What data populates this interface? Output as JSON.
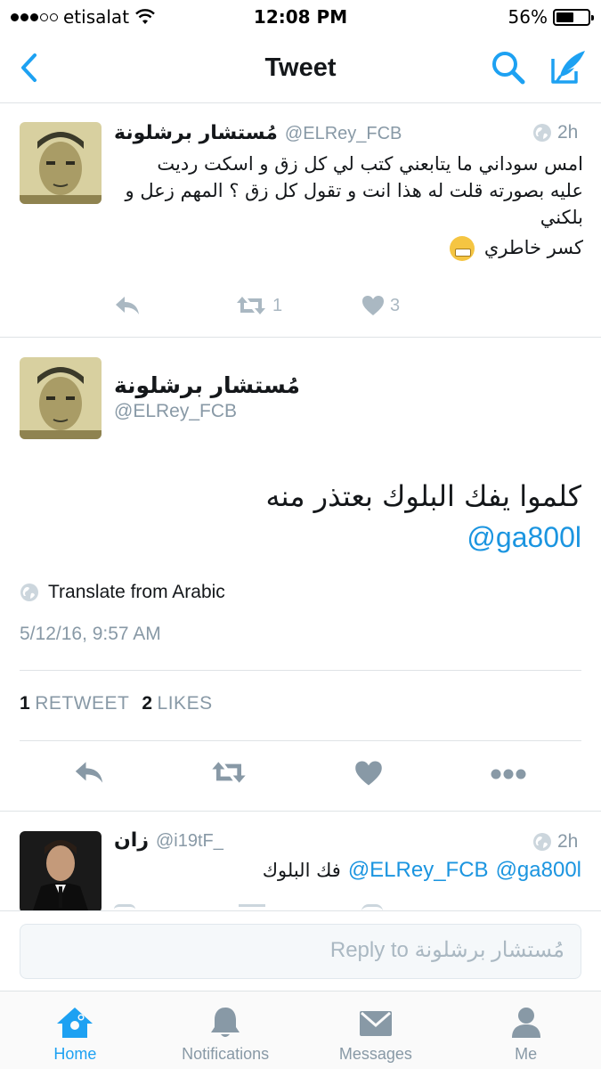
{
  "status_bar": {
    "carrier": "etisalat",
    "time": "12:08 PM",
    "battery_percent": "56%",
    "battery_level": 0.56
  },
  "nav": {
    "title": "Tweet",
    "back_icon": "chevron-left-icon",
    "search_icon": "search-icon",
    "compose_icon": "compose-icon"
  },
  "parent_tweet": {
    "display_name": "مُستشار برشلونة",
    "username": "@ELRey_FCB",
    "time": "2h",
    "text_line1": "امس سوداني ما يتابعني كتب لي كل زق و اسكت رديت عليه بصورته قلت له هذا انت و تقول كل زق ؟ المهم زعل و بلكني",
    "text_line2": "كسر خاطري",
    "retweets": "1",
    "likes": "3"
  },
  "main_tweet": {
    "display_name": "مُستشار برشلونة",
    "username": "@ELRey_FCB",
    "text": "كلموا يفك البلوك بعتذر منه",
    "mention": "@ga800l",
    "translate": "Translate from Arabic",
    "timestamp": "5/12/16, 9:57 AM",
    "retweet_count": "1",
    "retweet_label": "RETWEET",
    "like_count": "2",
    "like_label": "LIKES"
  },
  "reply_tweet": {
    "display_name": "زان",
    "username": "@i19tF_",
    "time": "2h",
    "mention1": "@ELRey_FCB",
    "mention2": "@ga800l",
    "text": "فك البلوك"
  },
  "reply_bar": {
    "placeholder": "Reply to مُستشار برشلونة"
  },
  "tabs": [
    {
      "label": "Home",
      "icon": "home-icon",
      "active": true
    },
    {
      "label": "Notifications",
      "icon": "bell-icon",
      "active": false
    },
    {
      "label": "Messages",
      "icon": "envelope-icon",
      "active": false
    },
    {
      "label": "Me",
      "icon": "person-icon",
      "active": false
    }
  ],
  "colors": {
    "accent": "#1da1f2",
    "link": "#1b95e0",
    "muted": "#8899a6",
    "action_gray": "#aab8c2"
  }
}
